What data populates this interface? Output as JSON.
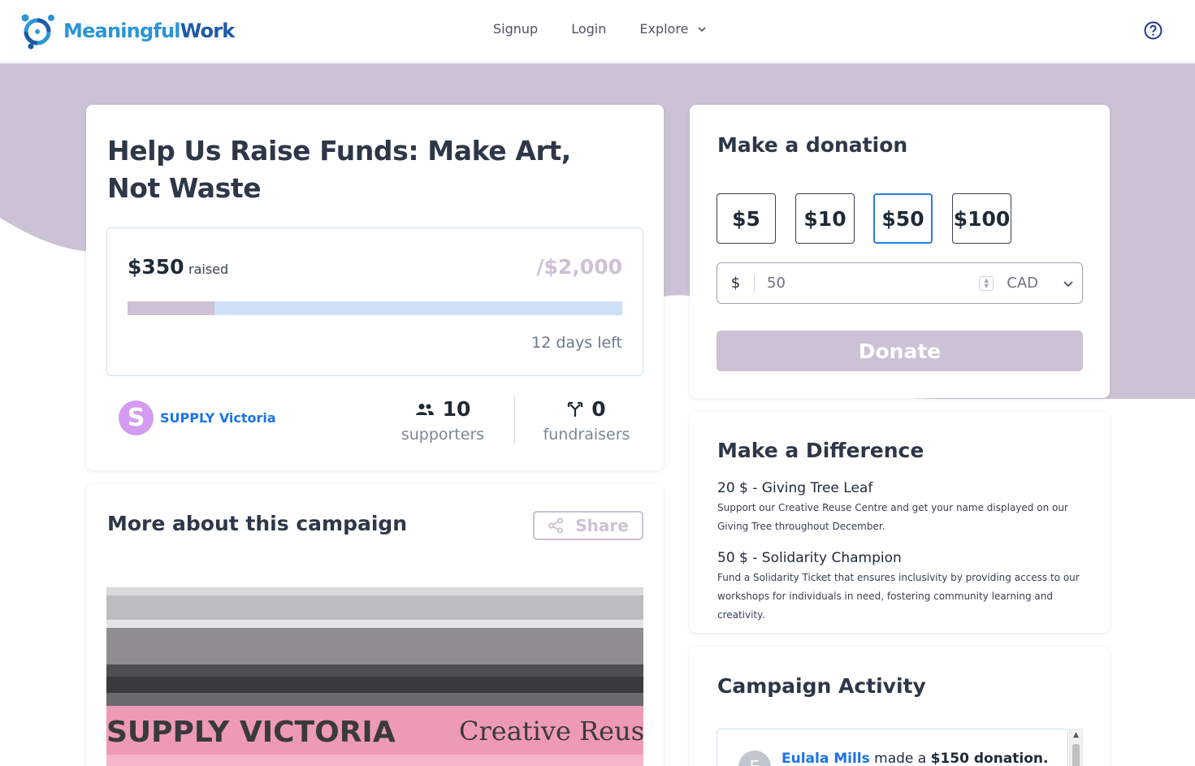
{
  "brand": {
    "word1": "Meaningful",
    "word2": "Work"
  },
  "nav": {
    "signup": "Signup",
    "login": "Login",
    "explore": "Explore"
  },
  "campaign": {
    "title": "Help Us Raise Funds: Make Art, Not Waste",
    "raised": "$350",
    "raised_label": "raised",
    "goal": "/$2,000",
    "progress_fraction": 0.175,
    "days_left": "12 days left",
    "org": {
      "initial": "S",
      "name": "SUPPLY Victoria"
    },
    "supporters": {
      "count": "10",
      "label": "supporters"
    },
    "fundraisers": {
      "count": "0",
      "label": "fundraisers"
    }
  },
  "more": {
    "title": "More about this campaign",
    "share": "Share"
  },
  "donate": {
    "title": "Make a donation",
    "amounts": [
      "$5",
      "$10",
      "$50",
      "$100"
    ],
    "selected": "$50",
    "currency_symbol": "$",
    "value": "50",
    "currency": "CAD",
    "button": "Donate"
  },
  "difference": {
    "title": "Make a Difference",
    "tiers": [
      {
        "heading": "20 $ - Giving Tree Leaf",
        "desc": "Support our Creative Reuse Centre and get your name displayed on our Giving Tree throughout December."
      },
      {
        "heading": "50 $ - Solidarity Champion",
        "desc": "Fund a Solidarity Ticket that ensures inclusivity by providing access to our workshops for individuals in need, fostering community learning and creativity."
      }
    ]
  },
  "activity": {
    "title": "Campaign Activity",
    "items": [
      {
        "initial": "E",
        "name": "Eulala Mills",
        "verb": "made a",
        "amount": "$150 donation."
      }
    ]
  },
  "photo": {
    "sign_left": "SUPPLY VICTORIA",
    "sign_right": "Creative Reuse C"
  },
  "colors": {
    "brand_light": "#2b95d6",
    "brand_dark": "#1e5aa8",
    "lavender": "#cdc1d5",
    "link": "#1a73e8",
    "select": "#2b7be4"
  },
  "icons": [
    "logo-icon",
    "chevron-down-icon",
    "help-icon",
    "supporters-icon",
    "fundraisers-icon",
    "share-icon",
    "spinner-icon",
    "dropdown-chevron-icon"
  ]
}
